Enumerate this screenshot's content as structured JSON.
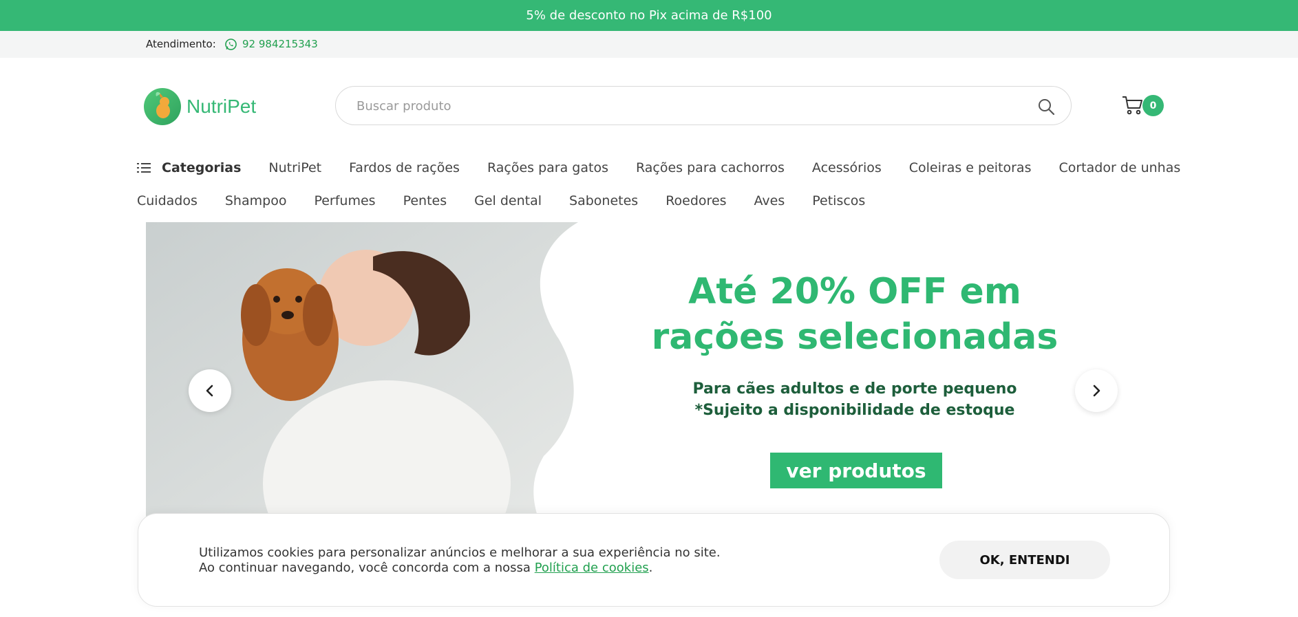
{
  "promo": {
    "text": "5% de desconto no Pix acima de R$100"
  },
  "contact": {
    "label": "Atendimento:",
    "phone": "92 984215343",
    "icon": "whatsapp-icon"
  },
  "header": {
    "logo_text": "NutriPet",
    "search_placeholder": "Buscar produto",
    "search_value": "",
    "cart_count": "0"
  },
  "nav": {
    "categories_label": "Categorias",
    "row1": [
      "NutriPet",
      "Fardos de rações",
      "Rações para gatos",
      "Rações para cachorros",
      "Acessórios",
      "Coleiras e peitoras",
      "Cortador de unhas"
    ],
    "row2": [
      "Cuidados",
      "Shampoo",
      "Perfumes",
      "Pentes",
      "Gel dental",
      "Sabonetes",
      "Roedores",
      "Aves",
      "Petiscos"
    ]
  },
  "banner": {
    "headline_line1": "Até 20% OFF em",
    "headline_line2": "rações selecionadas",
    "sub_line1": "Para cães adultos e de porte pequeno",
    "sub_line2": "*Sujeito a disponibilidade de estoque",
    "cta": "ver produtos"
  },
  "cookie": {
    "line1": "Utilizamos cookies para personalizar anúncios e melhorar a sua experiência no site.",
    "line2_prefix": "Ao continuar navegando, você concorda com a nossa ",
    "link": "Política de cookies",
    "line2_suffix": ".",
    "button": "OK, ENTENDI"
  },
  "colors": {
    "brand": "#35b875",
    "link": "#21a04f",
    "banner_text": "#2fb872"
  }
}
